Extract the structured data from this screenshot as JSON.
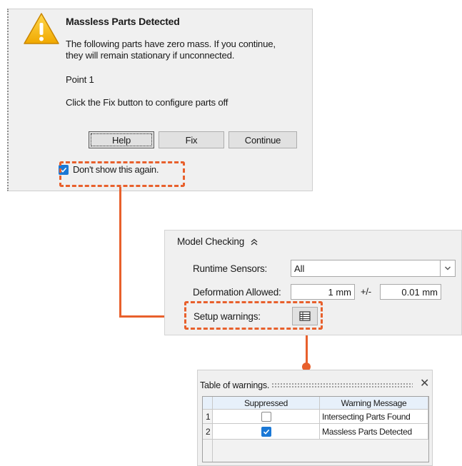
{
  "dialog": {
    "title": "Massless Parts Detected",
    "body_line1": "The following parts have zero mass. If you continue,",
    "body_line2": "they will remain stationary if unconnected.",
    "part": "Point 1",
    "hint": "Click the Fix button to configure parts off",
    "buttons": {
      "help": "Help",
      "fix": "Fix",
      "continue": "Continue"
    },
    "dont_show_label": "Don't show this again.",
    "dont_show_checked": true,
    "icon": "warning-triangle-icon"
  },
  "model_checking": {
    "title": "Model Checking",
    "runtime_sensors": {
      "label": "Runtime Sensors:",
      "value": "All"
    },
    "deformation": {
      "label": "Deformation Allowed:",
      "value": "1 mm",
      "separator": "+/-",
      "tolerance": "0.01 mm"
    },
    "setup_warnings": {
      "label": "Setup warnings:",
      "icon": "table-icon"
    }
  },
  "warnings_table": {
    "title": "Table of warnings.",
    "close_glyph": "✕",
    "columns": [
      "Suppressed",
      "Warning Message"
    ],
    "rows": [
      {
        "num": "1",
        "suppressed": false,
        "message": "Intersecting Parts Found"
      },
      {
        "num": "2",
        "suppressed": true,
        "message": "Massless Parts Detected"
      }
    ]
  },
  "colors": {
    "highlight": "#e8602c",
    "checkbox": "#1a78d6",
    "warning": "#f5b400"
  }
}
